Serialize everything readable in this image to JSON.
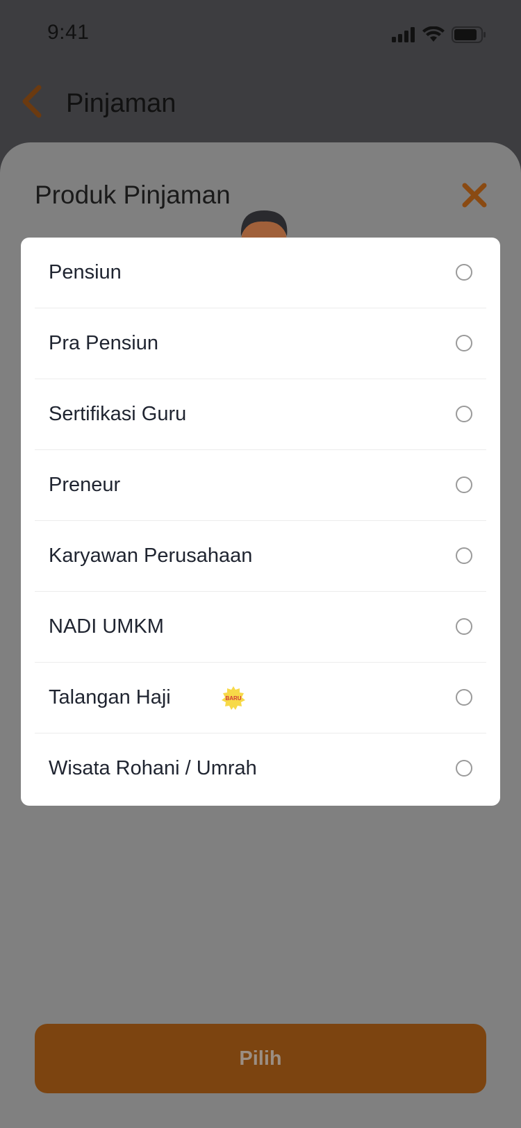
{
  "status_bar": {
    "time": "9:41"
  },
  "header": {
    "title": "Pinjaman"
  },
  "sheet": {
    "title": "Produk Pinjaman",
    "options": [
      {
        "label": "Pensiun"
      },
      {
        "label": "Pra Pensiun"
      },
      {
        "label": "Sertifikasi Guru"
      },
      {
        "label": "Preneur"
      },
      {
        "label": "Karyawan Perusahaan"
      },
      {
        "label": "NADI UMKM"
      },
      {
        "label": "Talangan Haji",
        "badge": "BARU"
      },
      {
        "label": "Wisata Rohani / Umrah"
      }
    ],
    "cta_label": "Pilih"
  },
  "colors": {
    "accent": "#8a4a12",
    "overlay": "#808080",
    "badge": "#f7d948",
    "badge_text": "#d23a3a"
  },
  "icons": [
    "signal-icon",
    "wifi-icon",
    "battery-icon",
    "back-icon",
    "close-icon",
    "mascot-illustration",
    "new-badge-icon",
    "radio-icon"
  ]
}
